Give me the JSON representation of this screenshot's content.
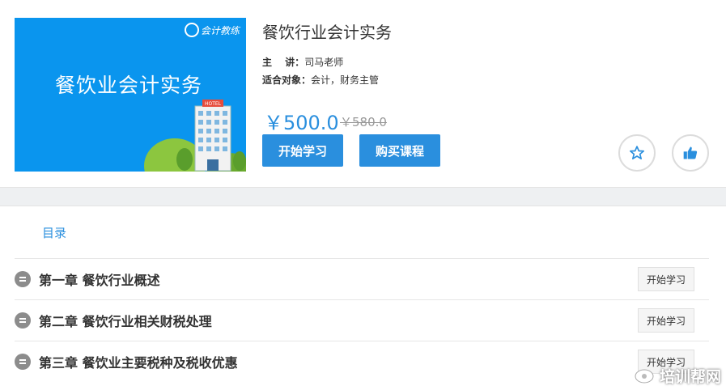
{
  "course": {
    "banner_title": "餐饮业会计实务",
    "banner_logo": "会计教练",
    "title": "餐饮行业会计实务",
    "lecturer_label": "主　 讲：",
    "lecturer": "司马老师",
    "target_label": "适合对象：",
    "target": "会计，财务主管",
    "price": "￥500.0",
    "original_price": "￥580.0",
    "start_label": "开始学习",
    "buy_label": "购买课程"
  },
  "catalog": {
    "title": "目录",
    "chapters": [
      {
        "name": "第一章  餐饮行业概述",
        "button": "开始学习"
      },
      {
        "name": "第二章  餐饮行业相关财税处理",
        "button": "开始学习"
      },
      {
        "name": "第三章  餐饮业主要税种及税收优惠",
        "button": "开始学习"
      }
    ]
  },
  "watermark": "培训帮网",
  "colors": {
    "accent": "#2a8fde",
    "banner": "#0a95ee"
  }
}
